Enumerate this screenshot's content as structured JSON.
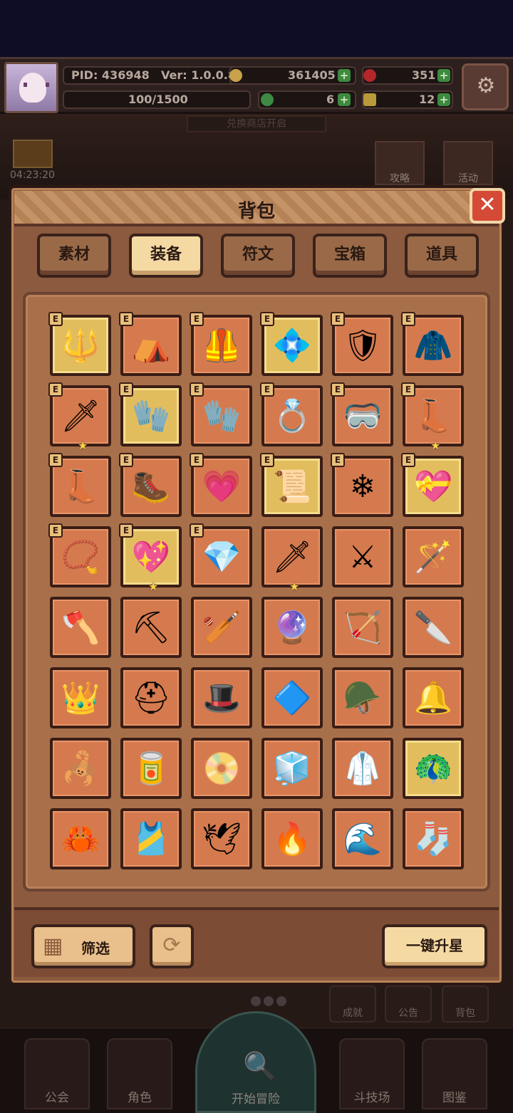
{
  "hud": {
    "pid": "PID: 436948",
    "version": "Ver: 1.0.0.8",
    "xp": "100/1500",
    "gold": "361405",
    "gems": "351",
    "clover": "6",
    "keys": "12"
  },
  "scene": {
    "shop_sign": "兑换商店开启",
    "timer": "04:23:20",
    "guide_label": "攻略",
    "event_label": "活动",
    "side_buttons": [
      "成就",
      "公告",
      "背包"
    ],
    "nav": [
      "公会",
      "角色",
      "开始冒险",
      "斗技场",
      "图鉴"
    ]
  },
  "panel": {
    "title": "背包",
    "close": "✕",
    "tabs": [
      {
        "label": "素材",
        "active": false
      },
      {
        "label": "装备",
        "active": true
      },
      {
        "label": "符文",
        "active": false
      },
      {
        "label": "宝箱",
        "active": false
      },
      {
        "label": "道具",
        "active": false
      }
    ],
    "filter_label": "筛选",
    "refresh_icon": "⟳",
    "star_up_label": "一键升星"
  },
  "items": [
    {
      "icon": "🔱",
      "name": "mace-icon",
      "gold": true,
      "badge": "E",
      "star": false
    },
    {
      "icon": "⛺",
      "name": "hood-icon",
      "gold": false,
      "badge": "E",
      "star": false
    },
    {
      "icon": "🦺",
      "name": "vest-icon",
      "gold": false,
      "badge": "E",
      "star": false
    },
    {
      "icon": "💠",
      "name": "crystal-armor-icon",
      "gold": true,
      "badge": "E",
      "star": false
    },
    {
      "icon": "🛡",
      "name": "dark-armor-icon",
      "gold": false,
      "badge": "E",
      "star": false
    },
    {
      "icon": "🧥",
      "name": "royal-coat-icon",
      "gold": false,
      "badge": "E",
      "star": false
    },
    {
      "icon": "🗡",
      "name": "ruby-sword-icon",
      "gold": false,
      "badge": "E",
      "star": true
    },
    {
      "icon": "🧤",
      "name": "ice-gauntlet-icon",
      "gold": true,
      "badge": "E",
      "star": false
    },
    {
      "icon": "🧤",
      "name": "gold-gauntlet-icon",
      "gold": false,
      "badge": "E",
      "star": false
    },
    {
      "icon": "💍",
      "name": "ring-icon",
      "gold": false,
      "badge": "E",
      "star": false
    },
    {
      "icon": "🥽",
      "name": "mask-icon",
      "gold": false,
      "badge": "E",
      "star": false
    },
    {
      "icon": "👢",
      "name": "royal-boots-icon",
      "gold": false,
      "badge": "E",
      "star": true
    },
    {
      "icon": "👢",
      "name": "gold-boots-icon",
      "gold": false,
      "badge": "E",
      "star": false
    },
    {
      "icon": "🥾",
      "name": "purple-boots-icon",
      "gold": false,
      "badge": "E",
      "star": false
    },
    {
      "icon": "💗",
      "name": "heart-charm-icon",
      "gold": false,
      "badge": "E",
      "star": false
    },
    {
      "icon": "📜",
      "name": "golden-tome-icon",
      "gold": true,
      "badge": "E",
      "star": false
    },
    {
      "icon": "❄",
      "name": "frost-gem-icon",
      "gold": false,
      "badge": "E",
      "star": false
    },
    {
      "icon": "💝",
      "name": "heart-amulet-icon",
      "gold": true,
      "badge": "E",
      "star": false
    },
    {
      "icon": "📿",
      "name": "necklace-icon",
      "gold": false,
      "badge": "E",
      "star": false
    },
    {
      "icon": "💖",
      "name": "winged-heart-icon",
      "gold": true,
      "badge": "E",
      "star": true
    },
    {
      "icon": "💎",
      "name": "silver-ring-icon",
      "gold": false,
      "badge": "E",
      "star": false
    },
    {
      "icon": "🗡",
      "name": "dark-sword-icon",
      "gold": false,
      "badge": "",
      "star": true
    },
    {
      "icon": "⚔",
      "name": "crossed-swords-icon",
      "gold": false,
      "badge": "",
      "star": false
    },
    {
      "icon": "🪄",
      "name": "blue-staff-icon",
      "gold": false,
      "badge": "",
      "star": false
    },
    {
      "icon": "🪓",
      "name": "axe-icon",
      "gold": false,
      "badge": "",
      "star": false
    },
    {
      "icon": "⛏",
      "name": "pickaxe-icon",
      "gold": false,
      "badge": "",
      "star": false
    },
    {
      "icon": "🏏",
      "name": "club-icon",
      "gold": false,
      "badge": "",
      "star": false
    },
    {
      "icon": "🔮",
      "name": "orb-wand-icon",
      "gold": false,
      "badge": "",
      "star": false
    },
    {
      "icon": "🏹",
      "name": "bow-icon",
      "gold": false,
      "badge": "",
      "star": false
    },
    {
      "icon": "🔪",
      "name": "dagger-icon",
      "gold": false,
      "badge": "",
      "star": false
    },
    {
      "icon": "👑",
      "name": "crown-icon",
      "gold": false,
      "badge": "",
      "star": false
    },
    {
      "icon": "⛑",
      "name": "crystal-helm-icon",
      "gold": false,
      "badge": "",
      "star": false
    },
    {
      "icon": "🎩",
      "name": "wizard-hat-icon",
      "gold": false,
      "badge": "",
      "star": false
    },
    {
      "icon": "🔷",
      "name": "ice-crown-icon",
      "gold": false,
      "badge": "",
      "star": false
    },
    {
      "icon": "🪖",
      "name": "winged-helm-icon",
      "gold": false,
      "badge": "",
      "star": false
    },
    {
      "icon": "🔔",
      "name": "blue-cap-icon",
      "gold": false,
      "badge": "",
      "star": false
    },
    {
      "icon": "🦂",
      "name": "demon-helm-icon",
      "gold": false,
      "badge": "",
      "star": false
    },
    {
      "icon": "🥫",
      "name": "knight-helm-icon",
      "gold": false,
      "badge": "",
      "star": false
    },
    {
      "icon": "📀",
      "name": "gold-circlet-icon",
      "gold": false,
      "badge": "",
      "star": false
    },
    {
      "icon": "🧊",
      "name": "ice-cloak-icon",
      "gold": false,
      "badge": "",
      "star": false
    },
    {
      "icon": "🥼",
      "name": "white-robe-icon",
      "gold": false,
      "badge": "",
      "star": false
    },
    {
      "icon": "🦚",
      "name": "sapphire-armor-icon",
      "gold": true,
      "badge": "",
      "star": false
    },
    {
      "icon": "🦀",
      "name": "teal-armor-icon",
      "gold": false,
      "badge": "",
      "star": false
    },
    {
      "icon": "🎽",
      "name": "gold-robe-icon",
      "gold": false,
      "badge": "",
      "star": false
    },
    {
      "icon": "🕊",
      "name": "feather-cape-icon",
      "gold": false,
      "badge": "",
      "star": false
    },
    {
      "icon": "🔥",
      "name": "red-armor-icon",
      "gold": false,
      "badge": "",
      "star": false
    },
    {
      "icon": "🌊",
      "name": "water-armor-icon",
      "gold": false,
      "badge": "",
      "star": false
    },
    {
      "icon": "🧦",
      "name": "steel-gauntlet-icon",
      "gold": false,
      "badge": "",
      "star": false
    }
  ]
}
